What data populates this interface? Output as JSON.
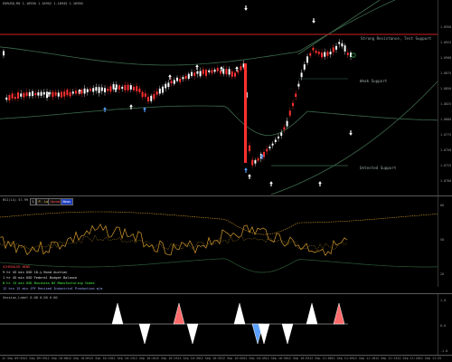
{
  "window": {
    "main_title": "EURUSD,M5 1.16950 1.16952 1.16945 1.16950",
    "indicator_title": "RSI(14) 57.99 62(37)",
    "bottom_title": "Session_Label 0.00 0.00 0.00"
  },
  "levels": {
    "strong_resistance": "Strong Resistance, Test Support",
    "weak_support": "Weak Support",
    "untested_support": "Untested Support"
  },
  "buttons": [
    {
      "label": "1"
    },
    {
      "label": "P. Low"
    },
    {
      "label": "Upcoming"
    },
    {
      "label": "News"
    }
  ],
  "news": {
    "header": "SCHEDULED NEWS",
    "items": [
      "9 hr 45 min USD  10-y Bond Auction",
      "1 hr 45 min USD  Federal Budget Balance",
      "8 hr 15 min USD  Business NZ Manufacturing Index",
      "12 hrs 15 min JPY  Revised Industrial Production m/m"
    ],
    "colors": [
      "#ff4c4c",
      "#e0e0e0",
      "#e0e0e0",
      "#4cff4c",
      "#9ab0ff"
    ]
  },
  "price_axis": [
    "1.8950",
    "1.8925",
    "1.8900",
    "1.8875",
    "1.8850",
    "1.8825",
    "1.8800",
    "1.8775",
    "1.8750",
    "1.8725",
    "1.8700"
  ],
  "ind_axis": [
    "80",
    "50",
    "20"
  ],
  "bot_axis": [
    "1.0",
    "0.0",
    "-1.0"
  ],
  "time_axis": [
    "12 Sep 09:50",
    "12 Sep 09:55",
    "12 Sep 10:00",
    "12 Sep 10:05",
    "12 Sep 10:10",
    "12 Sep 10:15",
    "12 Sep 10:20",
    "12 Sep 10:25",
    "12 Sep 10:30",
    "12 Sep 10:35",
    "12 Sep 10:40",
    "12 Sep 10:45",
    "12 Sep 10:50",
    "12 Sep 10:55",
    "12 Sep 11:00",
    "12 Sep 11:05",
    "12 Sep 11:10",
    "12 Sep 11:15",
    "12 Sep 11:20",
    "12 Sep 11:25"
  ],
  "colors": {
    "bull": "#ffffff",
    "bear": "#ff3030",
    "band": "#3c6b4c",
    "resistance_line": "#cc2222",
    "indicator": "#d49a2a",
    "indicator_band": "#2c5b35",
    "spike_up": "#ff6b6b",
    "spike_down": "#5aa0ff",
    "grid_text": "#999999"
  }
}
